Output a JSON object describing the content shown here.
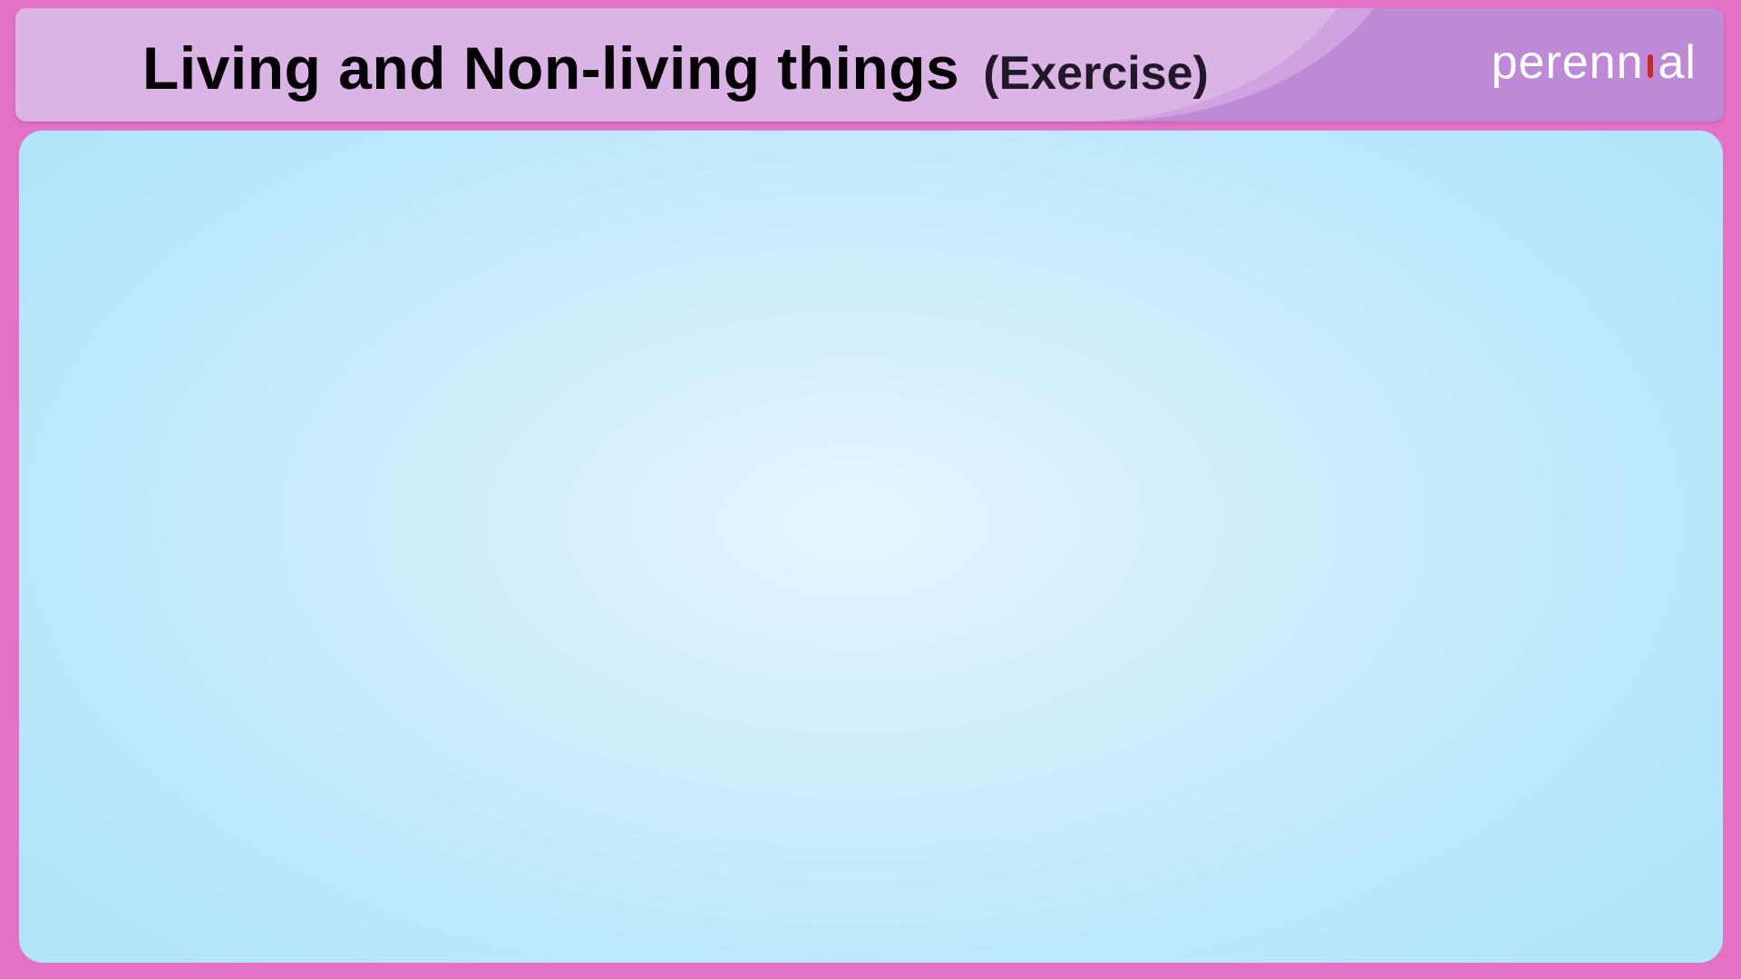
{
  "header": {
    "title": "Living and Non-living things",
    "subtitle": "(Exercise)",
    "logo": {
      "before_mark": "perenn",
      "after_mark": "al",
      "mark_icon": "red-i-dot-icon"
    }
  },
  "content": {
    "state": "empty"
  },
  "colors": {
    "border": "#e472c4",
    "header_dark": "#be8ad8",
    "header_light": "#dbb4e6",
    "content_center": "#e4f6fd",
    "content_edge": "#b3e5fa",
    "logo_mark": "#c02a2a"
  }
}
